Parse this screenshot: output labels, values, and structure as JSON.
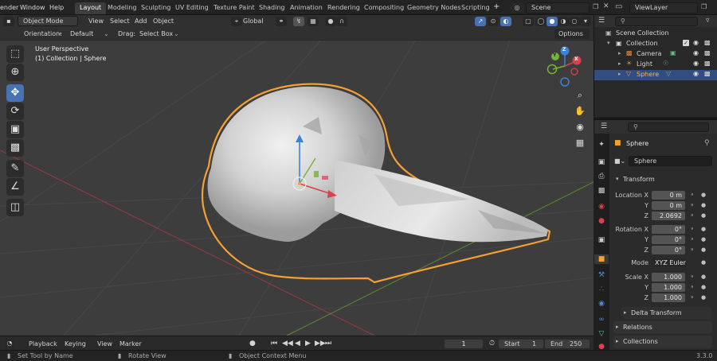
{
  "top_menu": {
    "items": [
      "ender",
      "Window",
      "Help"
    ],
    "workspace_tabs": [
      "Layout",
      "Modeling",
      "Sculpting",
      "UV Editing",
      "Texture Paint",
      "Shading",
      "Animation",
      "Rendering",
      "Compositing",
      "Geometry Nodes",
      "Scripting"
    ],
    "active_tab": "Layout",
    "add_tab": "+",
    "scene_name": "Scene",
    "view_layer": "ViewLayer"
  },
  "viewport_header": {
    "mode": "Object Mode",
    "menus": [
      "View",
      "Select",
      "Add",
      "Object"
    ],
    "transform_orientation": "Global"
  },
  "tool_header": {
    "orientation_label": "Orientation:",
    "orientation_value": "Default",
    "drag_label": "Drag:",
    "drag_value": "Select Box",
    "options": "Options"
  },
  "viewport": {
    "info_line1": "User Perspective",
    "info_line2": "(1) Collection | Sphere",
    "gizmo_axes": [
      "Z",
      "Y",
      "X"
    ]
  },
  "outliner": {
    "search_placeholder": "",
    "rows": [
      {
        "label": "Scene Collection"
      },
      {
        "label": "Collection"
      },
      {
        "label": "Camera"
      },
      {
        "label": "Light"
      },
      {
        "label": "Sphere"
      }
    ]
  },
  "properties": {
    "object_name": "Sphere",
    "datablock_name": "Sphere",
    "transform_label": "Transform",
    "location_labels": [
      "Location X",
      "Y",
      "Z"
    ],
    "location_values": [
      "0 m",
      "0 m",
      "2.0692"
    ],
    "rotation_labels": [
      "Rotation X",
      "Y",
      "Z"
    ],
    "rotation_values": [
      "0°",
      "0°",
      "0°"
    ],
    "mode_label": "Mode",
    "mode_value": "XYZ Euler",
    "scale_labels": [
      "Scale X",
      "Y",
      "Z"
    ],
    "scale_values": [
      "1.000",
      "1.000",
      "1.000"
    ],
    "delta_transform": "Delta Transform",
    "relations": "Relations",
    "collections": "Collections"
  },
  "timeline": {
    "menus": [
      "Playback",
      "Keying",
      "View",
      "Marker"
    ],
    "current_frame": "1",
    "start_label": "Start",
    "start_value": "1",
    "end_label": "End",
    "end_value": "250"
  },
  "status_bar": {
    "left": "Set Tool by Name",
    "middle": "Rotate View",
    "right": "Object Context Menu",
    "version": "3.3.0"
  },
  "colors": {
    "accent_blue": "#4772b3",
    "selection_orange": "#f5a032",
    "axis_x": "#d9414d",
    "axis_y": "#77b334",
    "axis_z": "#3d82d9"
  }
}
